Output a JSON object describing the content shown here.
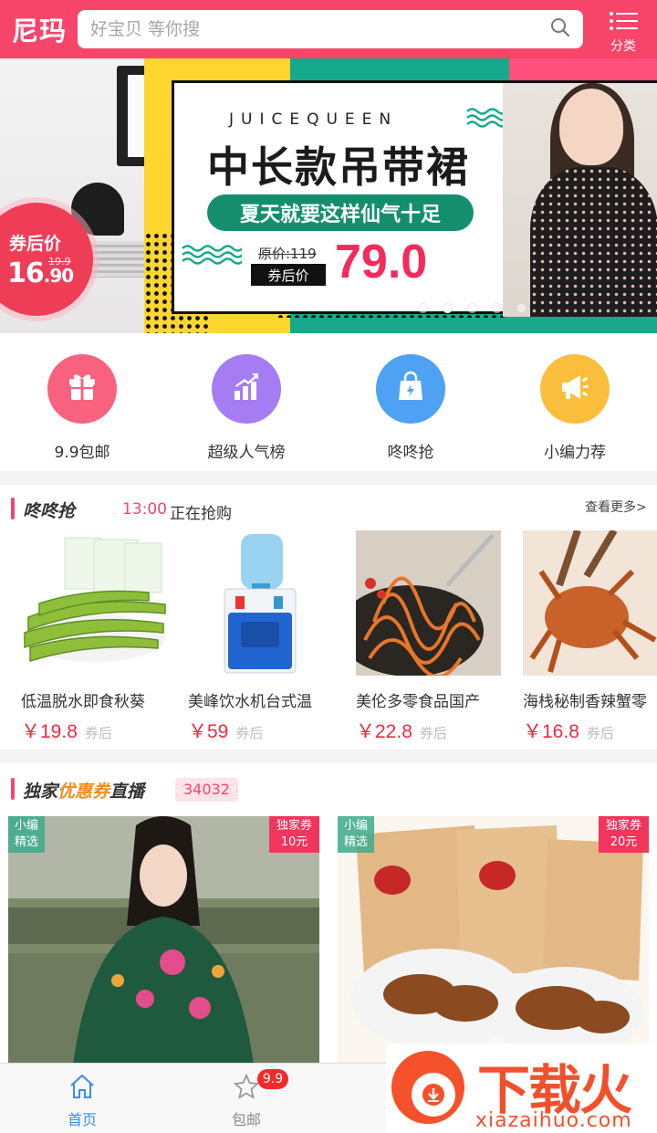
{
  "header": {
    "logo": "尼玛",
    "search_placeholder": "好宝贝 等你搜",
    "category_label": "分类"
  },
  "banner": {
    "left_tag_title": "券后价",
    "left_tag_price_int": "16",
    "left_tag_price_dec": ".90",
    "left_tag_orig": "19.9",
    "brand": "JUICEQUEEN",
    "title": "中长款吊带裙",
    "subtitle": "夏天就要这样仙气十足",
    "orig_price": "原价:119",
    "coupon_label": "券后价",
    "price": "79.0",
    "page_count": 5,
    "active_page": 2
  },
  "quicknav": [
    {
      "label": "9.9包邮",
      "icon": "gift-icon",
      "color": "#f8627f"
    },
    {
      "label": "超级人气榜",
      "icon": "chart-up-icon",
      "color": "#a57cf2"
    },
    {
      "label": "咚咚抢",
      "icon": "shopping-bag-icon",
      "color": "#4ea1f3"
    },
    {
      "label": "小编力荐",
      "icon": "megaphone-icon",
      "color": "#fbbd3c"
    }
  ],
  "flash": {
    "title": "咚咚抢",
    "time": "13:00",
    "status": "正在抢购",
    "more": "查看更多>",
    "items": [
      {
        "name": "低温脱水即食秋葵",
        "price": "￥19.8",
        "tag": "券后"
      },
      {
        "name": "美峰饮水机台式温",
        "price": "￥59",
        "tag": "券后"
      },
      {
        "name": "美伦多零食品国产",
        "price": "￥22.8",
        "tag": "券后"
      },
      {
        "name": "海栈秘制香辣蟹零",
        "price": "￥16.8",
        "tag": "券后"
      }
    ]
  },
  "exclusive": {
    "title_a": "独家",
    "title_b": "优惠券",
    "title_c": "直播",
    "count": "34032",
    "cards": [
      {
        "badge_left": "小编 精选",
        "badge_right_a": "独家券",
        "badge_right_b": "10元"
      },
      {
        "badge_left": "小编 精选",
        "badge_right_a": "独家券",
        "badge_right_b": "20元"
      }
    ]
  },
  "tabbar": {
    "tabs": [
      {
        "label": "首页",
        "icon": "home-icon",
        "active": true
      },
      {
        "label": "包邮",
        "icon": "star-icon",
        "badge": "9.9"
      }
    ]
  },
  "watermark": {
    "title": "下载火",
    "url": "xiazaihuo.com"
  }
}
